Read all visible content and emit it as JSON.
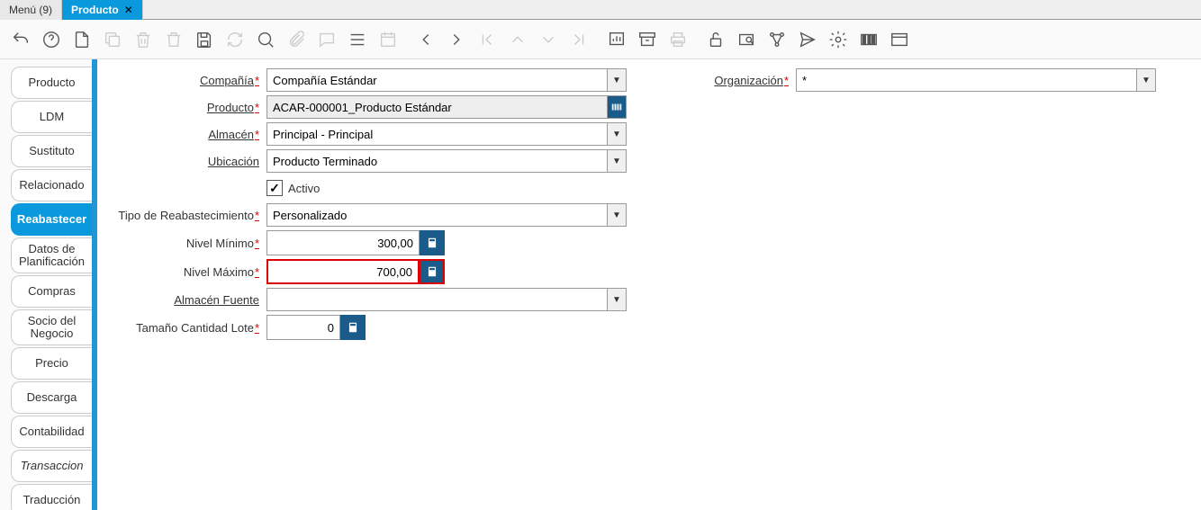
{
  "tabs": {
    "menu": "Menú (9)",
    "producto": "Producto"
  },
  "sidetabs": {
    "producto": "Producto",
    "ldm": "LDM",
    "sustituto": "Sustituto",
    "relacionado": "Relacionado",
    "reabastecer": "Reabastecer",
    "datos_plan": "Datos de Planificación",
    "compras": "Compras",
    "socio": "Socio del Negocio",
    "precio": "Precio",
    "descarga": "Descarga",
    "contabilidad": "Contabilidad",
    "transaccion": "Transaccion",
    "traduccion": "Traducción"
  },
  "labels": {
    "compania": "Compañía",
    "organizacion": "Organización",
    "producto": "Producto",
    "almacen": "Almacén",
    "ubicacion": "Ubicación",
    "activo": "Activo",
    "tipo_reab": "Tipo de Reabastecimiento",
    "nivel_min": "Nivel Mínimo",
    "nivel_max": "Nivel Máximo",
    "almacen_fuente": "Almacén Fuente",
    "tamano_lote": "Tamaño Cantidad Lote"
  },
  "values": {
    "compania": "Compañía Estándar",
    "organizacion": "*",
    "producto": "ACAR-000001_Producto Estándar",
    "almacen": "Principal - Principal",
    "ubicacion": "Producto Terminado",
    "activo": true,
    "tipo_reab": "Personalizado",
    "nivel_min": "300,00",
    "nivel_max": "700,00",
    "almacen_fuente": "",
    "tamano_lote": "0"
  }
}
